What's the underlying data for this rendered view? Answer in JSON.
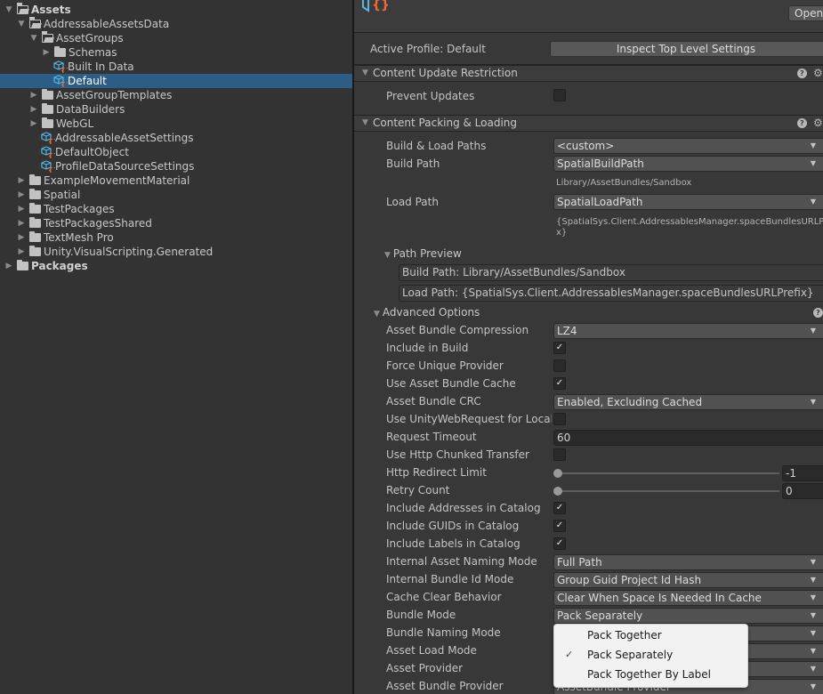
{
  "project_tree": {
    "items": [
      {
        "label": "Assets",
        "depth": 0,
        "expanded": true,
        "icon": "folder-open-icon",
        "bold": true
      },
      {
        "label": "AddressableAssetsData",
        "depth": 1,
        "expanded": true,
        "icon": "folder-open-icon"
      },
      {
        "label": "AssetGroups",
        "depth": 2,
        "expanded": true,
        "icon": "folder-open-icon"
      },
      {
        "label": "Schemas",
        "depth": 3,
        "expanded": false,
        "icon": "folder-icon"
      },
      {
        "label": "Built In Data",
        "depth": 3,
        "icon": "scriptable-object-icon",
        "leaf": true
      },
      {
        "label": "Default",
        "depth": 3,
        "icon": "scriptable-object-icon",
        "leaf": true,
        "selected": true
      },
      {
        "label": "AssetGroupTemplates",
        "depth": 2,
        "expanded": false,
        "icon": "folder-icon"
      },
      {
        "label": "DataBuilders",
        "depth": 2,
        "expanded": false,
        "icon": "folder-icon"
      },
      {
        "label": "WebGL",
        "depth": 2,
        "expanded": false,
        "icon": "folder-icon"
      },
      {
        "label": "AddressableAssetSettings",
        "depth": 2,
        "icon": "scriptable-object-icon",
        "leaf": true
      },
      {
        "label": "DefaultObject",
        "depth": 2,
        "icon": "scriptable-object-icon",
        "leaf": true
      },
      {
        "label": "ProfileDataSourceSettings",
        "depth": 2,
        "icon": "scriptable-object-icon",
        "leaf": true
      },
      {
        "label": "ExampleMovementMaterial",
        "depth": 1,
        "expanded": false,
        "icon": "folder-icon"
      },
      {
        "label": "Spatial",
        "depth": 1,
        "expanded": false,
        "icon": "folder-icon"
      },
      {
        "label": "TestPackages",
        "depth": 1,
        "expanded": false,
        "icon": "folder-icon"
      },
      {
        "label": "TestPackagesShared",
        "depth": 1,
        "expanded": false,
        "icon": "folder-icon"
      },
      {
        "label": "TextMesh Pro",
        "depth": 1,
        "expanded": false,
        "icon": "folder-icon"
      },
      {
        "label": "Unity.VisualScripting.Generated",
        "depth": 1,
        "expanded": false,
        "icon": "folder-icon"
      },
      {
        "label": "Packages",
        "depth": 0,
        "expanded": false,
        "icon": "folder-icon",
        "bold": true
      }
    ]
  },
  "inspector": {
    "open_button": "Open",
    "active_profile": "Active Profile: Default",
    "inspect_button": "Inspect Top Level Settings",
    "content_update": {
      "title": "Content Update Restriction",
      "prevent_updates_label": "Prevent Updates",
      "prevent_updates": false
    },
    "packing": {
      "title": "Content Packing & Loading",
      "build_load_paths_label": "Build & Load Paths",
      "build_load_paths_value": "<custom>",
      "build_path_label": "Build Path",
      "build_path_value": "SpatialBuildPath",
      "build_path_resolved": "Library/AssetBundles/Sandbox",
      "load_path_label": "Load Path",
      "load_path_value": "SpatialLoadPath",
      "load_path_resolved_line1": "{SpatialSys.Client.AddressablesManager.spaceBundlesURLPrefi",
      "load_path_resolved_line2": "x}",
      "path_preview_title": "Path Preview",
      "preview_build": "Build Path: Library/AssetBundles/Sandbox",
      "preview_load": "Load Path: {SpatialSys.Client.AddressablesManager.spaceBundlesURLPrefix}"
    },
    "advanced": {
      "title": "Advanced Options",
      "fields": [
        {
          "label": "Asset Bundle Compression",
          "type": "dropdown",
          "value": "LZ4"
        },
        {
          "label": "Include in Build",
          "type": "checkbox",
          "value": true
        },
        {
          "label": "Force Unique Provider",
          "type": "checkbox",
          "value": false
        },
        {
          "label": "Use Asset Bundle Cache",
          "type": "checkbox",
          "value": true
        },
        {
          "label": "Asset Bundle CRC",
          "type": "dropdown",
          "value": "Enabled, Excluding Cached"
        },
        {
          "label": "Use UnityWebRequest for Local Asset Bundles",
          "type": "checkbox",
          "value": false
        },
        {
          "label": "Request Timeout",
          "type": "text",
          "value": "60"
        },
        {
          "label": "Use Http Chunked Transfer",
          "type": "checkbox",
          "value": false
        },
        {
          "label": "Http Redirect Limit",
          "type": "slider",
          "value": "-1"
        },
        {
          "label": "Retry Count",
          "type": "slider",
          "value": "0"
        },
        {
          "label": "Include Addresses in Catalog",
          "type": "checkbox",
          "value": true
        },
        {
          "label": "Include GUIDs in Catalog",
          "type": "checkbox",
          "value": true
        },
        {
          "label": "Include Labels in Catalog",
          "type": "checkbox",
          "value": true
        },
        {
          "label": "Internal Asset Naming Mode",
          "type": "dropdown",
          "value": "Full Path"
        },
        {
          "label": "Internal Bundle Id Mode",
          "type": "dropdown",
          "value": "Group Guid Project Id Hash"
        },
        {
          "label": "Cache Clear Behavior",
          "type": "dropdown",
          "value": "Clear When Space Is Needed In Cache"
        },
        {
          "label": "Bundle Mode",
          "type": "dropdown",
          "value": "Pack Separately"
        },
        {
          "label": "Bundle Naming Mode",
          "type": "dropdown",
          "value": ""
        },
        {
          "label": "Asset Load Mode",
          "type": "dropdown",
          "value": ""
        },
        {
          "label": "Asset Provider",
          "type": "dropdown",
          "value": ""
        },
        {
          "label": "Asset Bundle Provider",
          "type": "dropdown",
          "value": "AssetBundle Provider"
        }
      ]
    }
  },
  "bundle_mode_popup": {
    "options": [
      {
        "label": "Pack Together",
        "checked": false
      },
      {
        "label": "Pack Separately",
        "checked": true
      },
      {
        "label": "Pack Together By Label",
        "checked": false
      }
    ]
  },
  "colors": {
    "selection": "#2c5d87",
    "asset_icon_blue": "#5bb6e6",
    "asset_icon_orange": "#f26a3a"
  }
}
